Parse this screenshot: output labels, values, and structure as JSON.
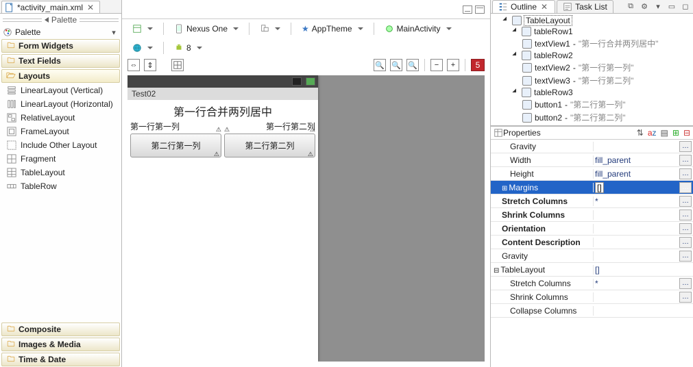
{
  "tabs": {
    "left": "*activity_main.xml"
  },
  "palette": {
    "header": "Palette",
    "title": "Palette",
    "cats": {
      "formWidgets": "Form Widgets",
      "textFields": "Text Fields",
      "layouts": "Layouts",
      "composite": "Composite",
      "images": "Images & Media",
      "time": "Time & Date"
    },
    "layoutItems": [
      "LinearLayout (Vertical)",
      "LinearLayout (Horizontal)",
      "RelativeLayout",
      "FrameLayout",
      "Include Other Layout",
      "Fragment",
      "TableLayout",
      "TableRow"
    ]
  },
  "toolbar": {
    "device": "Nexus One",
    "theme": "AppTheme",
    "activity": "MainActivity",
    "api": "8",
    "errors": "5"
  },
  "device": {
    "appName": "Test02",
    "row1": "第一行合并两列居中",
    "cellA": "第一行第一列",
    "cellB": "第一行第二列",
    "btnA": "第二行第一列",
    "btnB": "第二行第二列"
  },
  "outline": {
    "tabOutline": "Outline",
    "tabTaskList": "Task List",
    "root": "TableLayout",
    "r1": "tableRow1",
    "r1c1": "textView1",
    "r1c1t": "\"第一行合并两列居中\"",
    "r2": "tableRow2",
    "r2c1": "textView2",
    "r2c1t": "\"第一行第一列\"",
    "r2c2": "textView3",
    "r2c2t": "\"第一行第二列\"",
    "r3": "tableRow3",
    "r3c1": "button1",
    "r3c1t": "\"第二行第一列\"",
    "r3c2": "button2",
    "r3c2t": "\"第二行第二列\""
  },
  "props": {
    "title": "Properties",
    "rows": {
      "gravity1": {
        "k": "Gravity",
        "v": ""
      },
      "width": {
        "k": "Width",
        "v": "fill_parent"
      },
      "height": {
        "k": "Height",
        "v": "fill_parent"
      },
      "margins": {
        "k": "Margins",
        "v": "[]"
      },
      "stretch": {
        "k": "Stretch Columns",
        "v": "*"
      },
      "shrink": {
        "k": "Shrink Columns",
        "v": ""
      },
      "orient": {
        "k": "Orientation",
        "v": ""
      },
      "cdesc": {
        "k": "Content Description",
        "v": ""
      },
      "gravity2": {
        "k": "Gravity",
        "v": ""
      },
      "group": {
        "k": "TableLayout",
        "v": "[]"
      },
      "stretch2": {
        "k": "Stretch Columns",
        "v": "*"
      },
      "shrink2": {
        "k": "Shrink Columns",
        "v": ""
      },
      "collapse": {
        "k": "Collapse Columns",
        "v": ""
      }
    }
  }
}
